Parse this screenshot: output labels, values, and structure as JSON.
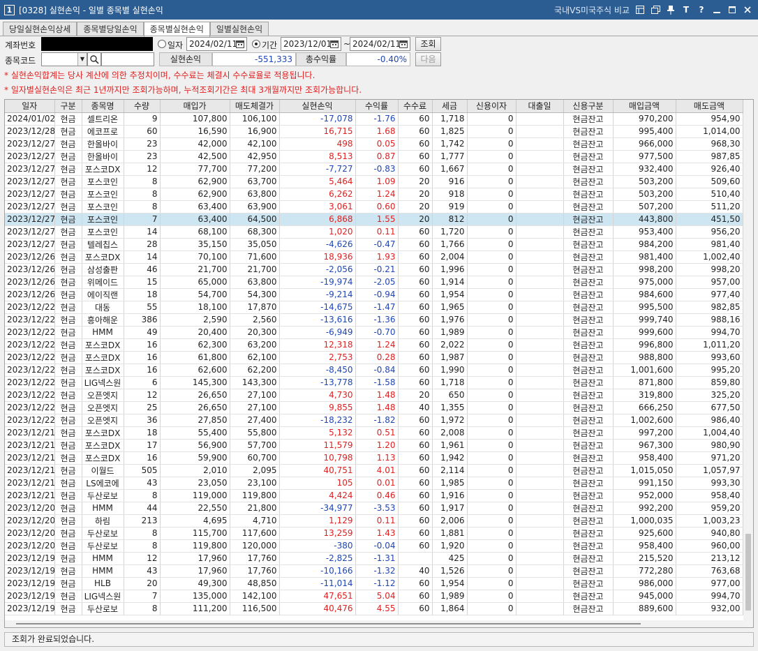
{
  "window": {
    "number": "1",
    "title": "[0328] 실현손익 - 일별 종목별 실현손익",
    "link": "국내VS미국주식 비교",
    "icons": [
      "layout-icon",
      "copy-window-icon",
      "pin-icon",
      "font-icon",
      "help-icon",
      "minimize-icon",
      "maximize-icon",
      "close-icon"
    ]
  },
  "tabs": [
    {
      "label": "당일실현손익상세",
      "active": false
    },
    {
      "label": "종목별당일손익",
      "active": false
    },
    {
      "label": "종목별실현손익",
      "active": true
    },
    {
      "label": "일별실현손익",
      "active": false
    }
  ],
  "filters": {
    "account_label": "계좌번호",
    "date_radio_label": "일자",
    "date_value": "2024/02/11",
    "period_radio_label": "기간",
    "period_from": "2023/12/01",
    "period_sep": "~",
    "period_to": "2024/02/11",
    "query_button": "조회",
    "code_label": "종목코드",
    "next_button": "다음"
  },
  "summary": {
    "pnl_label": "실현손익",
    "pnl_value": "-551,333",
    "rate_label": "총수익률",
    "rate_value": "-0.40%"
  },
  "notes": [
    "* 실현손익합계는 당사 계산에 의한 추정치이며, 수수료는 체결시 수수료율로 적용됩니다.",
    "* 일자별실현손익은 최근 1년까지만 조회가능하며, 누적조회기간은 최대 3개월까지만 조회가능합니다."
  ],
  "table": {
    "columns": [
      "일자",
      "구분",
      "종목명",
      "수량",
      "매입가",
      "매도체결가",
      "실현손익",
      "수익률",
      "수수료",
      "세금",
      "신용이자",
      "대출일",
      "신용구분",
      "매입금액",
      "매도금액"
    ],
    "rows": [
      [
        "2024/01/02",
        "현금",
        "셀트리온",
        "9",
        "107,800",
        "106,100",
        "-17,078",
        "-1.76",
        "60",
        "1,718",
        "0",
        "",
        "현금잔고",
        "970,200",
        "954,90"
      ],
      [
        "2023/12/28",
        "현금",
        "에코프로",
        "60",
        "16,590",
        "16,900",
        "16,715",
        "1.68",
        "60",
        "1,825",
        "0",
        "",
        "현금잔고",
        "995,400",
        "1,014,00"
      ],
      [
        "2023/12/27",
        "현금",
        "한올바이",
        "23",
        "42,000",
        "42,100",
        "498",
        "0.05",
        "60",
        "1,742",
        "0",
        "",
        "현금잔고",
        "966,000",
        "968,30"
      ],
      [
        "2023/12/27",
        "현금",
        "한올바이",
        "23",
        "42,500",
        "42,950",
        "8,513",
        "0.87",
        "60",
        "1,777",
        "0",
        "",
        "현금잔고",
        "977,500",
        "987,85"
      ],
      [
        "2023/12/27",
        "현금",
        "포스코DX",
        "12",
        "77,700",
        "77,200",
        "-7,727",
        "-0.83",
        "60",
        "1,667",
        "0",
        "",
        "현금잔고",
        "932,400",
        "926,40"
      ],
      [
        "2023/12/27",
        "현금",
        "포스코인",
        "8",
        "62,900",
        "63,700",
        "5,464",
        "1.09",
        "20",
        "916",
        "0",
        "",
        "현금잔고",
        "503,200",
        "509,60"
      ],
      [
        "2023/12/27",
        "현금",
        "포스코인",
        "8",
        "62,900",
        "63,800",
        "6,262",
        "1.24",
        "20",
        "918",
        "0",
        "",
        "현금잔고",
        "503,200",
        "510,40"
      ],
      [
        "2023/12/27",
        "현금",
        "포스코인",
        "8",
        "63,400",
        "63,900",
        "3,061",
        "0.60",
        "20",
        "919",
        "0",
        "",
        "현금잔고",
        "507,200",
        "511,20"
      ],
      [
        "2023/12/27",
        "현금",
        "포스코인",
        "7",
        "63,400",
        "64,500",
        "6,868",
        "1.55",
        "20",
        "812",
        "0",
        "",
        "현금잔고",
        "443,800",
        "451,50"
      ],
      [
        "2023/12/27",
        "현금",
        "포스코인",
        "14",
        "68,100",
        "68,300",
        "1,020",
        "0.11",
        "60",
        "1,720",
        "0",
        "",
        "현금잔고",
        "953,400",
        "956,20"
      ],
      [
        "2023/12/27",
        "현금",
        "텔레칩스",
        "28",
        "35,150",
        "35,050",
        "-4,626",
        "-0.47",
        "60",
        "1,766",
        "0",
        "",
        "현금잔고",
        "984,200",
        "981,40"
      ],
      [
        "2023/12/26",
        "현금",
        "포스코DX",
        "14",
        "70,100",
        "71,600",
        "18,936",
        "1.93",
        "60",
        "2,004",
        "0",
        "",
        "현금잔고",
        "981,400",
        "1,002,40"
      ],
      [
        "2023/12/26",
        "현금",
        "삼성출판",
        "46",
        "21,700",
        "21,700",
        "-2,056",
        "-0.21",
        "60",
        "1,996",
        "0",
        "",
        "현금잔고",
        "998,200",
        "998,20"
      ],
      [
        "2023/12/26",
        "현금",
        "위메이드",
        "15",
        "65,000",
        "63,800",
        "-19,974",
        "-2.05",
        "60",
        "1,914",
        "0",
        "",
        "현금잔고",
        "975,000",
        "957,00"
      ],
      [
        "2023/12/26",
        "현금",
        "에이직랜",
        "18",
        "54,700",
        "54,300",
        "-9,214",
        "-0.94",
        "60",
        "1,954",
        "0",
        "",
        "현금잔고",
        "984,600",
        "977,40"
      ],
      [
        "2023/12/22",
        "현금",
        "대동",
        "55",
        "18,100",
        "17,870",
        "-14,675",
        "-1.47",
        "60",
        "1,965",
        "0",
        "",
        "현금잔고",
        "995,500",
        "982,85"
      ],
      [
        "2023/12/22",
        "현금",
        "흥아해운",
        "386",
        "2,590",
        "2,560",
        "-13,616",
        "-1.36",
        "60",
        "1,976",
        "0",
        "",
        "현금잔고",
        "999,740",
        "988,16"
      ],
      [
        "2023/12/22",
        "현금",
        "HMM",
        "49",
        "20,400",
        "20,300",
        "-6,949",
        "-0.70",
        "60",
        "1,989",
        "0",
        "",
        "현금잔고",
        "999,600",
        "994,70"
      ],
      [
        "2023/12/22",
        "현금",
        "포스코DX",
        "16",
        "62,300",
        "63,200",
        "12,318",
        "1.24",
        "60",
        "2,022",
        "0",
        "",
        "현금잔고",
        "996,800",
        "1,011,20"
      ],
      [
        "2023/12/22",
        "현금",
        "포스코DX",
        "16",
        "61,800",
        "62,100",
        "2,753",
        "0.28",
        "60",
        "1,987",
        "0",
        "",
        "현금잔고",
        "988,800",
        "993,60"
      ],
      [
        "2023/12/22",
        "현금",
        "포스코DX",
        "16",
        "62,600",
        "62,200",
        "-8,450",
        "-0.84",
        "60",
        "1,990",
        "0",
        "",
        "현금잔고",
        "1,001,600",
        "995,20"
      ],
      [
        "2023/12/22",
        "현금",
        "LIG넥스원",
        "6",
        "145,300",
        "143,300",
        "-13,778",
        "-1.58",
        "60",
        "1,718",
        "0",
        "",
        "현금잔고",
        "871,800",
        "859,80"
      ],
      [
        "2023/12/22",
        "현금",
        "오픈엣지",
        "12",
        "26,650",
        "27,100",
        "4,730",
        "1.48",
        "20",
        "650",
        "0",
        "",
        "현금잔고",
        "319,800",
        "325,20"
      ],
      [
        "2023/12/22",
        "현금",
        "오픈엣지",
        "25",
        "26,650",
        "27,100",
        "9,855",
        "1.48",
        "40",
        "1,355",
        "0",
        "",
        "현금잔고",
        "666,250",
        "677,50"
      ],
      [
        "2023/12/22",
        "현금",
        "오픈엣지",
        "36",
        "27,850",
        "27,400",
        "-18,232",
        "-1.82",
        "60",
        "1,972",
        "0",
        "",
        "현금잔고",
        "1,002,600",
        "986,40"
      ],
      [
        "2023/12/21",
        "현금",
        "포스코DX",
        "18",
        "55,400",
        "55,800",
        "5,132",
        "0.51",
        "60",
        "2,008",
        "0",
        "",
        "현금잔고",
        "997,200",
        "1,004,40"
      ],
      [
        "2023/12/21",
        "현금",
        "포스코DX",
        "17",
        "56,900",
        "57,700",
        "11,579",
        "1.20",
        "60",
        "1,961",
        "0",
        "",
        "현금잔고",
        "967,300",
        "980,90"
      ],
      [
        "2023/12/21",
        "현금",
        "포스코DX",
        "16",
        "59,900",
        "60,700",
        "10,798",
        "1.13",
        "60",
        "1,942",
        "0",
        "",
        "현금잔고",
        "958,400",
        "971,20"
      ],
      [
        "2023/12/21",
        "현금",
        "이월드",
        "505",
        "2,010",
        "2,095",
        "40,751",
        "4.01",
        "60",
        "2,114",
        "0",
        "",
        "현금잔고",
        "1,015,050",
        "1,057,97"
      ],
      [
        "2023/12/21",
        "현금",
        "LS에코에",
        "43",
        "23,050",
        "23,100",
        "105",
        "0.01",
        "60",
        "1,985",
        "0",
        "",
        "현금잔고",
        "991,150",
        "993,30"
      ],
      [
        "2023/12/21",
        "현금",
        "두산로보",
        "8",
        "119,000",
        "119,800",
        "4,424",
        "0.46",
        "60",
        "1,916",
        "0",
        "",
        "현금잔고",
        "952,000",
        "958,40"
      ],
      [
        "2023/12/20",
        "현금",
        "HMM",
        "44",
        "22,550",
        "21,800",
        "-34,977",
        "-3.53",
        "60",
        "1,917",
        "0",
        "",
        "현금잔고",
        "992,200",
        "959,20"
      ],
      [
        "2023/12/20",
        "현금",
        "하림",
        "213",
        "4,695",
        "4,710",
        "1,129",
        "0.11",
        "60",
        "2,006",
        "0",
        "",
        "현금잔고",
        "1,000,035",
        "1,003,23"
      ],
      [
        "2023/12/20",
        "현금",
        "두산로보",
        "8",
        "115,700",
        "117,600",
        "13,259",
        "1.43",
        "60",
        "1,881",
        "0",
        "",
        "현금잔고",
        "925,600",
        "940,80"
      ],
      [
        "2023/12/20",
        "현금",
        "두산로보",
        "8",
        "119,800",
        "120,000",
        "-380",
        "-0.04",
        "60",
        "1,920",
        "0",
        "",
        "현금잔고",
        "958,400",
        "960,00"
      ],
      [
        "2023/12/19",
        "현금",
        "HMM",
        "12",
        "17,960",
        "17,760",
        "-2,825",
        "-1.31",
        "",
        "425",
        "0",
        "",
        "현금잔고",
        "215,520",
        "213,12"
      ],
      [
        "2023/12/19",
        "현금",
        "HMM",
        "43",
        "17,960",
        "17,760",
        "-10,166",
        "-1.32",
        "40",
        "1,526",
        "0",
        "",
        "현금잔고",
        "772,280",
        "763,68"
      ],
      [
        "2023/12/19",
        "현금",
        "HLB",
        "20",
        "49,300",
        "48,850",
        "-11,014",
        "-1.12",
        "60",
        "1,954",
        "0",
        "",
        "현금잔고",
        "986,000",
        "977,00"
      ],
      [
        "2023/12/19",
        "현금",
        "LIG넥스원",
        "7",
        "135,000",
        "142,100",
        "47,651",
        "5.04",
        "60",
        "1,989",
        "0",
        "",
        "현금잔고",
        "945,000",
        "994,70"
      ],
      [
        "2023/12/19",
        "현금",
        "두산로보",
        "8",
        "111,200",
        "116,500",
        "40,476",
        "4.55",
        "60",
        "1,864",
        "0",
        "",
        "현금잔고",
        "889,600",
        "932,00"
      ]
    ],
    "selected_row": 8
  },
  "status": "조회가 완료되었습니다.",
  "colors": {
    "titlebar": "#2c5d92",
    "positive": "#e02020",
    "negative": "#1f46b4",
    "selected_row": "#cde6f2"
  }
}
